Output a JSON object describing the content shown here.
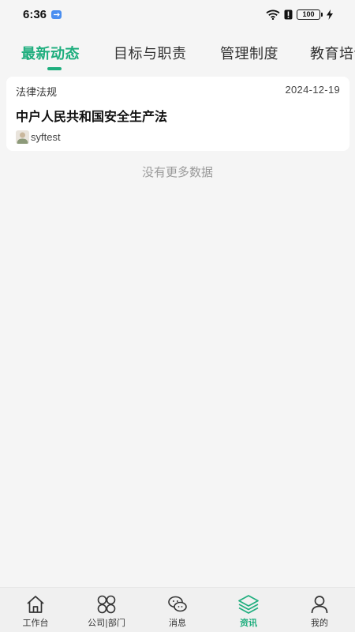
{
  "status_bar": {
    "time": "6:36",
    "battery": "100"
  },
  "tabs": [
    {
      "label": "最新动态",
      "active": true
    },
    {
      "label": "目标与职责",
      "active": false
    },
    {
      "label": "管理制度",
      "active": false
    },
    {
      "label": "教育培训",
      "active": false
    }
  ],
  "news": [
    {
      "category": "法律法规",
      "date": "2024-12-19",
      "title": "中户人民共和国安全生产法",
      "author": "syftest"
    }
  ],
  "list_footer": "没有更多数据",
  "bottom_nav": [
    {
      "label": "工作台",
      "icon": "home-icon",
      "active": false
    },
    {
      "label": "公司|部门",
      "icon": "grid-icon",
      "active": false
    },
    {
      "label": "消息",
      "icon": "chat-icon",
      "active": false
    },
    {
      "label": "资讯",
      "icon": "layers-icon",
      "active": true
    },
    {
      "label": "我的",
      "icon": "user-icon",
      "active": false
    }
  ],
  "colors": {
    "accent": "#1fae7e",
    "background": "#f5f5f5"
  }
}
